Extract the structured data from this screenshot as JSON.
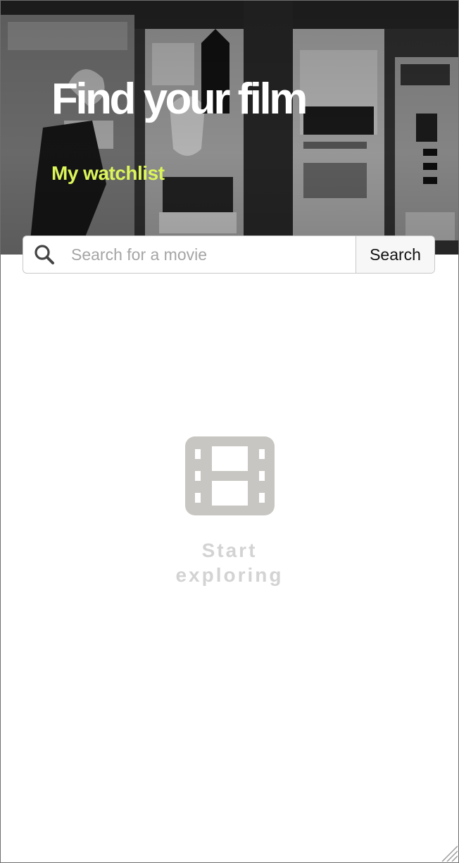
{
  "hero": {
    "title": "Find your film",
    "watchlist_link": "My watchlist",
    "background": "black-and-white photo of vintage posters on a wall",
    "accent_color": "#dcf55a"
  },
  "search": {
    "icon": "search-icon",
    "placeholder": "Search for a movie",
    "value": "",
    "button_label": "Search"
  },
  "empty_state": {
    "icon": "film-icon",
    "message": "Start exploring"
  }
}
